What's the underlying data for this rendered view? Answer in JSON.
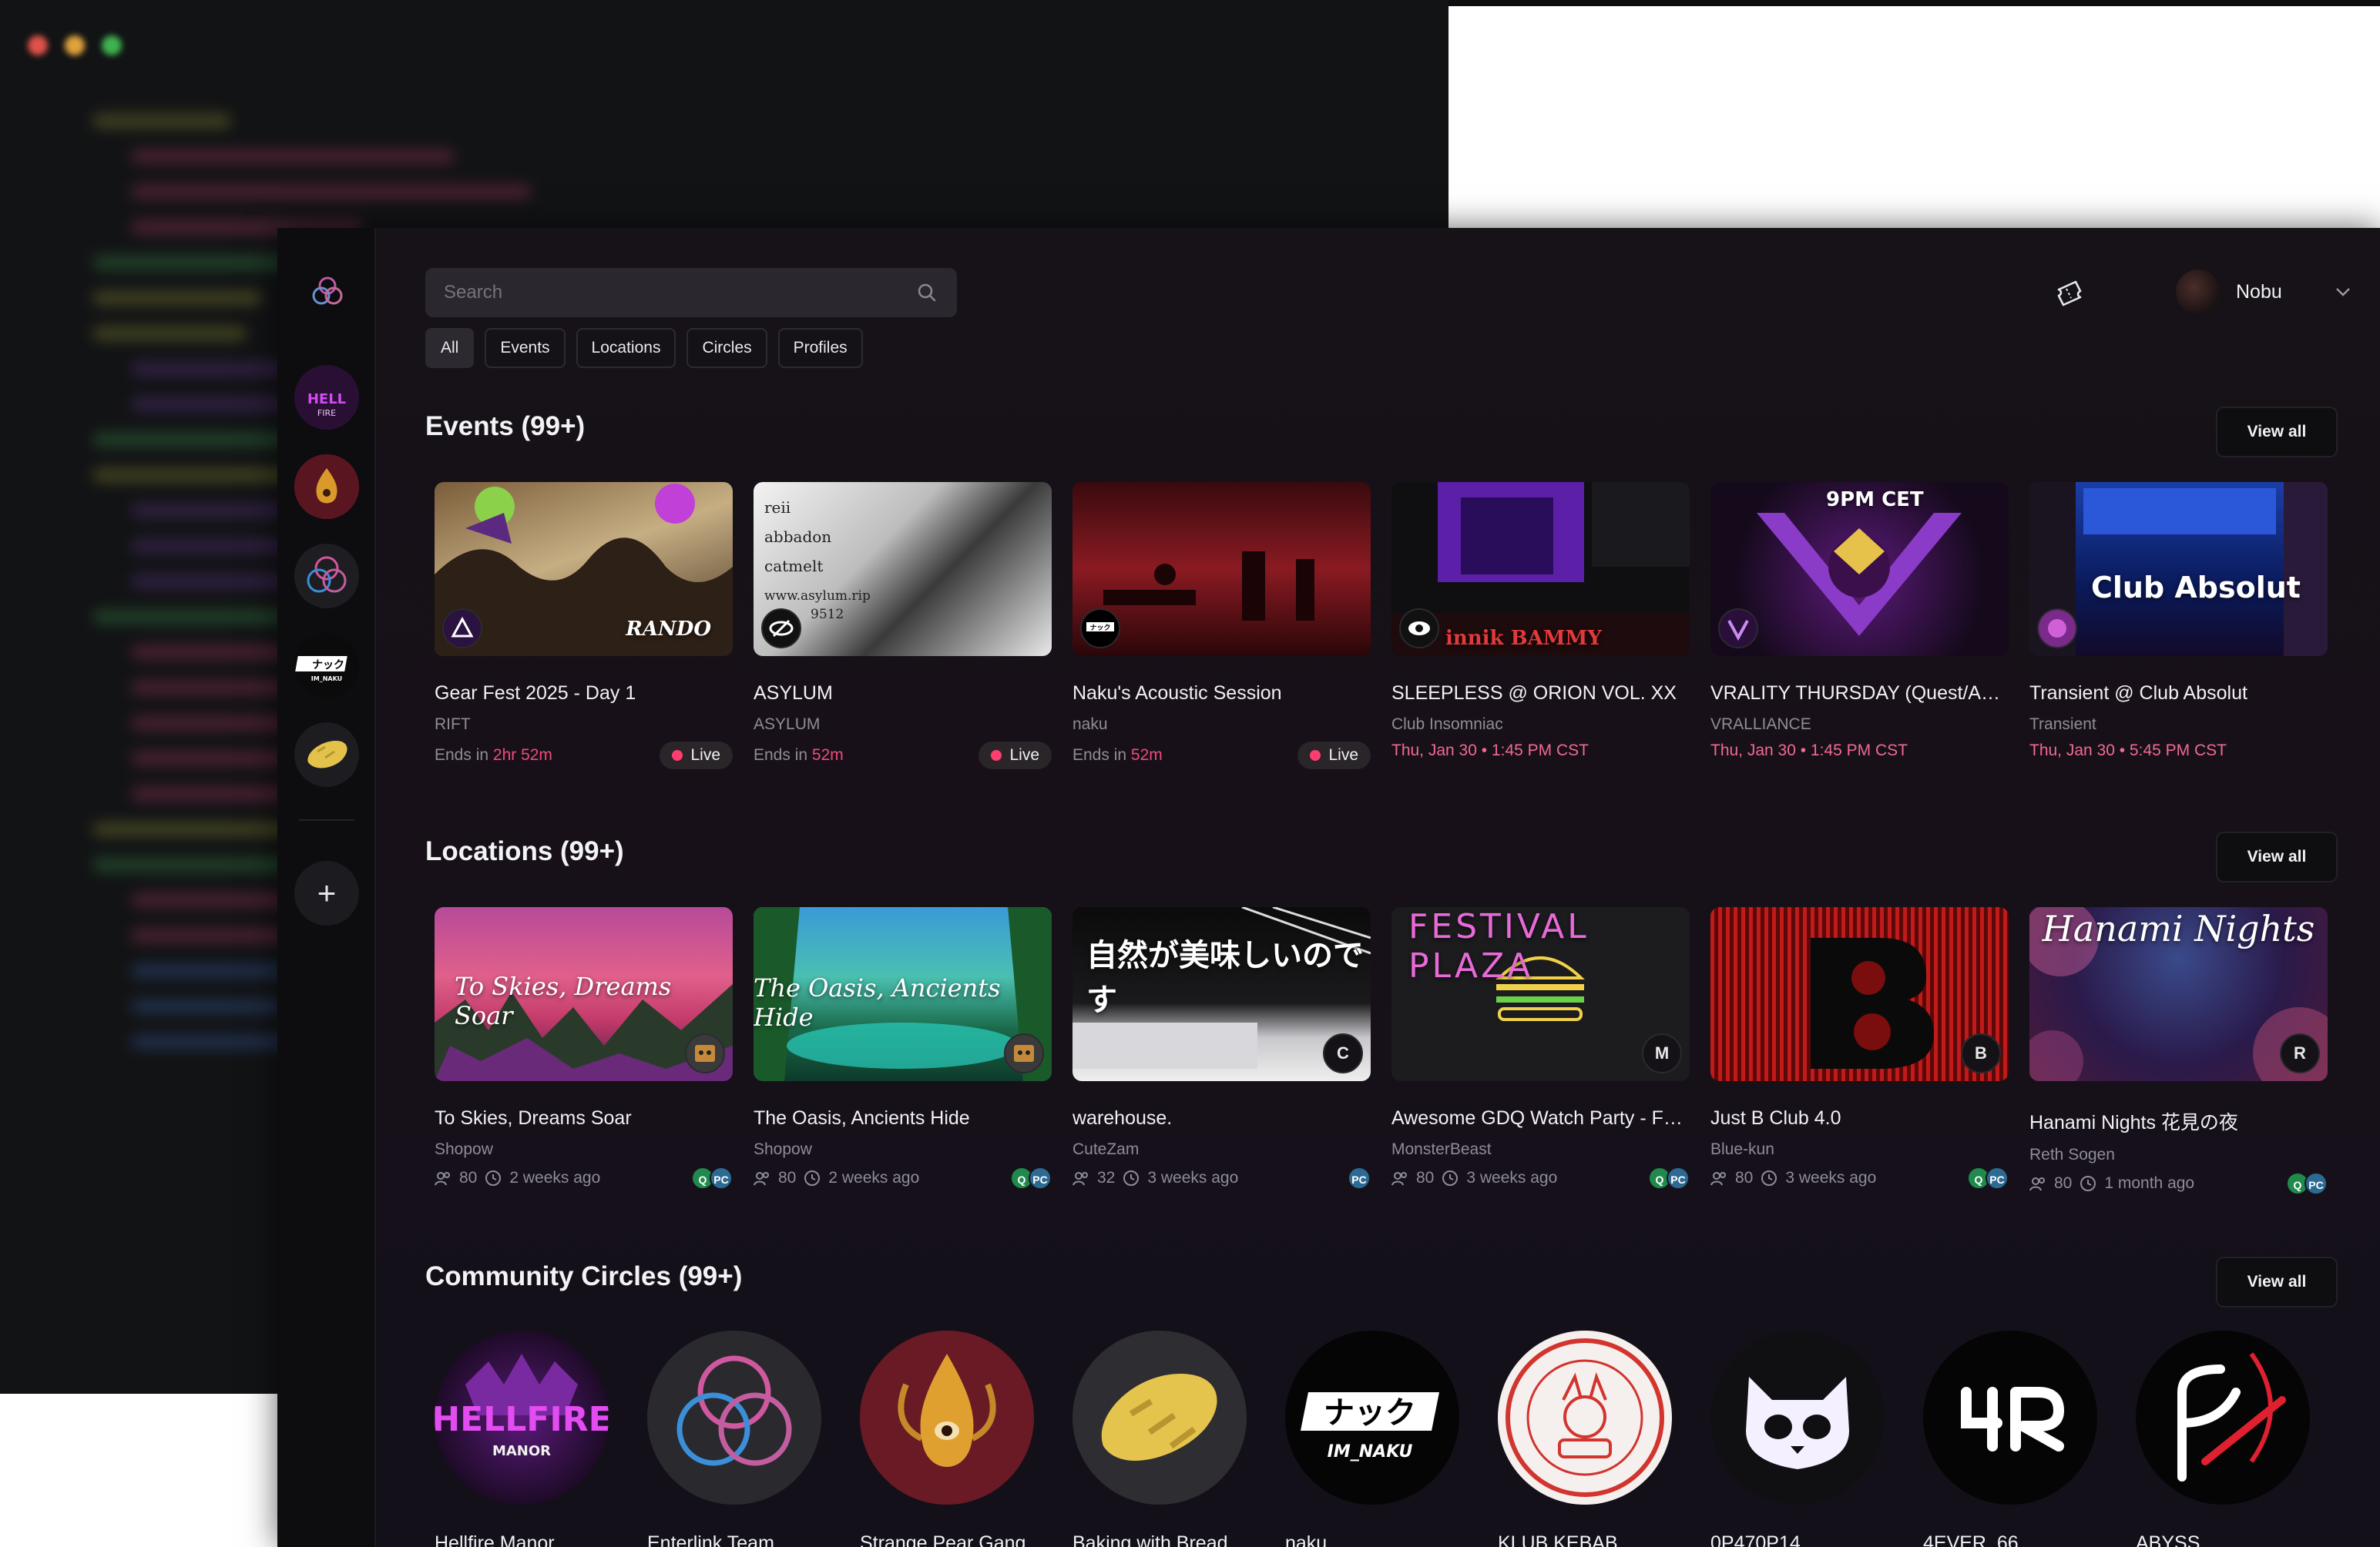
{
  "user": {
    "name": "Nobu"
  },
  "search": {
    "placeholder": "Search"
  },
  "filters": [
    "All",
    "Events",
    "Locations",
    "Circles",
    "Profiles"
  ],
  "view_all_label": "View all",
  "live_label": "Live",
  "events": {
    "title": "Events (99+)",
    "items": [
      {
        "title": "Gear Fest 2025 - Day 1",
        "host": "RIFT",
        "prefix": "Ends in",
        "time": "2hr 52m",
        "live": true,
        "thumb_text": "RANDO"
      },
      {
        "title": "ASYLUM",
        "host": "ASYLUM",
        "prefix": "Ends in",
        "time": "52m",
        "live": true,
        "thumb_lines": [
          "reii",
          "abbadon",
          "catmelt",
          "www.asylum.rip",
          "9512"
        ]
      },
      {
        "title": "Naku's Acoustic Session",
        "host": "naku",
        "prefix": "Ends in",
        "time": "52m",
        "live": true
      },
      {
        "title": "SLEEPLESS @ ORION VOL. XX",
        "host": "Club Insomniac",
        "prefix": "",
        "time": "Thu, Jan 30 • 1:45 PM CST",
        "live": false,
        "thumb_text": "innik  BAMMY"
      },
      {
        "title": "VRALITY THURSDAY (Quest/Android)",
        "host": "VRALLIANCE",
        "prefix": "",
        "time": "Thu, Jan 30 • 1:45 PM CST",
        "live": false,
        "thumb_text": "9PM CET"
      },
      {
        "title": "Transient @ Club Absolut",
        "host": "Transient",
        "prefix": "",
        "time": "Thu, Jan 30 • 5:45 PM CST",
        "live": false,
        "thumb_text": "Club Absolut"
      }
    ]
  },
  "locations": {
    "title": "Locations (99+)",
    "items": [
      {
        "title": "To Skies, Dreams Soar",
        "author": "Shopow",
        "users": "80",
        "ago": "2 weeks ago",
        "platforms": [
          "Q",
          "PC"
        ],
        "thumb_text": "To Skies, Dreams Soar"
      },
      {
        "title": "The Oasis, Ancients Hide",
        "author": "Shopow",
        "users": "80",
        "ago": "2 weeks ago",
        "platforms": [
          "Q",
          "PC"
        ],
        "thumb_text": "The Oasis, Ancients Hide"
      },
      {
        "title": "warehouse.",
        "author": "CuteZam",
        "users": "32",
        "ago": "3 weeks ago",
        "platforms": [
          "PC"
        ],
        "badge": "C",
        "thumb_text": "自然が美味しいのです"
      },
      {
        "title": "Awesome GDQ Watch Party - Festival Plaza",
        "author": "MonsterBeast",
        "users": "80",
        "ago": "3 weeks ago",
        "platforms": [
          "Q",
          "PC"
        ],
        "badge": "M",
        "thumb_text": "FESTIVAL PLAZA"
      },
      {
        "title": "Just B Club 4.0",
        "author": "Blue-kun",
        "users": "80",
        "ago": "3 weeks ago",
        "platforms": [
          "Q",
          "PC"
        ],
        "badge": "B"
      },
      {
        "title": "Hanami Nights 花見の夜",
        "author": "Reth Sogen",
        "users": "80",
        "ago": "1 month ago",
        "platforms": [
          "Q",
          "PC"
        ],
        "badge": "R",
        "thumb_text": "Hanami Nights"
      }
    ]
  },
  "circles": {
    "title": "Community Circles (99+)",
    "items": [
      {
        "name": "Hellfire Manor"
      },
      {
        "name": "Enterlink Team"
      },
      {
        "name": "Strange Pear Gang"
      },
      {
        "name": "Baking with Bread"
      },
      {
        "name": "naku"
      },
      {
        "name": "KLUB KEBAB"
      },
      {
        "name": "0P470P14"
      },
      {
        "name": "4EVER_66"
      },
      {
        "name": "ABYSS"
      }
    ]
  },
  "colors": {
    "accent": "#ef4b7a",
    "live": "#ff3d6e",
    "quest": "#1f8a4c",
    "pc": "#2d6a93"
  }
}
